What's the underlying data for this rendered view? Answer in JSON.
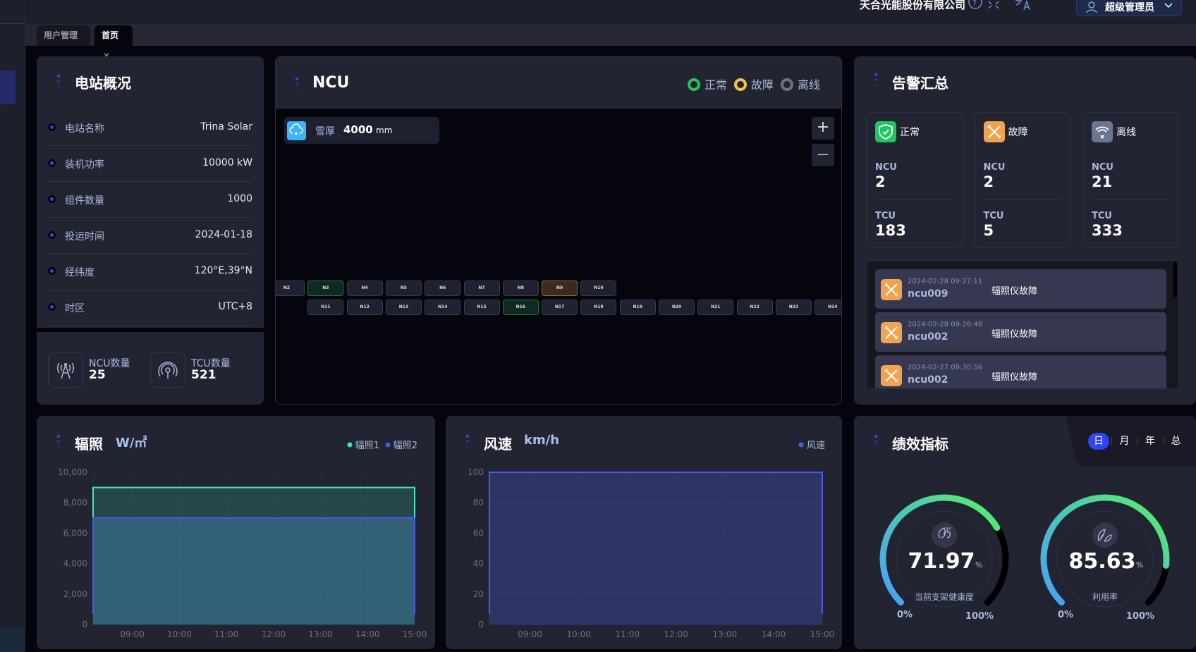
{
  "header": {
    "company": "天合光能股份有限公司",
    "user": "超级管理员",
    "icons": [
      "help-icon",
      "fullscreen-icon",
      "translate-icon",
      "bell-icon",
      "user-icon",
      "chevron-down-icon"
    ]
  },
  "tabs": [
    {
      "label": "用户管理",
      "active": false
    },
    {
      "label": "首页",
      "active": true,
      "close": "×"
    }
  ],
  "station": {
    "title": "电站概况",
    "rows": [
      {
        "label": "电站名称",
        "value": "Trina Solar"
      },
      {
        "label": "装机功率",
        "value": "10000 kW"
      },
      {
        "label": "组件数量",
        "value": "1000"
      },
      {
        "label": "投运时间",
        "value": "2024-01-18"
      },
      {
        "label": "经纬度",
        "value": "120°E,39°N"
      },
      {
        "label": "时区",
        "value": "UTC+8"
      }
    ],
    "ncu_label": "NCU数量",
    "ncu_count": "25",
    "tcu_label": "TCU数量",
    "tcu_count": "521"
  },
  "ncu": {
    "title": "NCU",
    "legend": [
      {
        "label": "正常",
        "color": "#22c55e"
      },
      {
        "label": "故障",
        "color": "#f5c542"
      },
      {
        "label": "离线",
        "color": "#6b7385"
      }
    ],
    "snow_label": "雪厚",
    "snow_value": "4000",
    "snow_unit": "mm",
    "zoom_in": "+",
    "zoom_out": "—",
    "row1": [
      {
        "id": "N2",
        "s": ""
      },
      {
        "id": "N3",
        "s": "ok"
      },
      {
        "id": "N4",
        "s": ""
      },
      {
        "id": "N5",
        "s": ""
      },
      {
        "id": "N6",
        "s": ""
      },
      {
        "id": "N7",
        "s": ""
      },
      {
        "id": "N8",
        "s": ""
      },
      {
        "id": "N9",
        "s": "fault"
      },
      {
        "id": "N10",
        "s": ""
      }
    ],
    "row2": [
      {
        "id": "N11",
        "s": ""
      },
      {
        "id": "N12",
        "s": ""
      },
      {
        "id": "N13",
        "s": ""
      },
      {
        "id": "N14",
        "s": ""
      },
      {
        "id": "N15",
        "s": ""
      },
      {
        "id": "N16",
        "s": "ok"
      },
      {
        "id": "N17",
        "s": ""
      },
      {
        "id": "N18",
        "s": ""
      },
      {
        "id": "N19",
        "s": ""
      },
      {
        "id": "N20",
        "s": ""
      },
      {
        "id": "N21",
        "s": ""
      },
      {
        "id": "N22",
        "s": ""
      },
      {
        "id": "N23",
        "s": ""
      },
      {
        "id": "N24",
        "s": ""
      }
    ]
  },
  "alarm": {
    "title": "告警汇总",
    "cards": [
      {
        "status": "正常",
        "color": "#22c55e",
        "ncu_label": "NCU",
        "ncu": "2",
        "tcu_label": "TCU",
        "tcu": "183"
      },
      {
        "status": "故障",
        "color": "#f3a34e",
        "ncu_label": "NCU",
        "ncu": "2",
        "tcu_label": "TCU",
        "tcu": "5"
      },
      {
        "status": "离线",
        "color": "#6b7690",
        "ncu_label": "NCU",
        "ncu": "21",
        "tcu_label": "TCU",
        "tcu": "333"
      }
    ],
    "items": [
      {
        "time": "2024-02-28 09:27:11",
        "device": "ncu009",
        "msg": "辐照仪故障"
      },
      {
        "time": "2024-02-28 09:26:48",
        "device": "ncu002",
        "msg": "辐照仪故障"
      },
      {
        "time": "2024-02-27 09:30:56",
        "device": "ncu002",
        "msg": "辐照仪故障"
      }
    ]
  },
  "perf": {
    "title": "绩效指标",
    "periods": [
      "日",
      "月",
      "年",
      "总"
    ],
    "active_period": "日",
    "gauges": [
      {
        "value": "71.97",
        "unit": "%",
        "label": "当前支架健康度",
        "min": "0%",
        "max": "100%",
        "fraction": 0.7197,
        "icon": "plug-leaf-icon"
      },
      {
        "value": "85.63",
        "unit": "%",
        "label": "利用率",
        "min": "0%",
        "max": "100%",
        "fraction": 0.8563,
        "icon": "leaves-icon"
      }
    ]
  },
  "chart_data": [
    {
      "type": "area",
      "title": "辐照",
      "unit": "W/㎡",
      "ylim": [
        0,
        10000
      ],
      "yticks": [
        "0",
        "2,000",
        "4,000",
        "6,000",
        "8,000",
        "10,000"
      ],
      "xticks": [
        "09:00",
        "10:00",
        "11:00",
        "12:00",
        "13:00",
        "14:00",
        "15:00"
      ],
      "xrange": [
        "08:10",
        "15:00"
      ],
      "grid": true,
      "legend": "top-right",
      "x": [
        "08:10",
        "09:00",
        "10:00",
        "11:00",
        "12:00",
        "13:00",
        "14:00",
        "15:00"
      ],
      "series": [
        {
          "name": "辐照1",
          "color": "#3ee6c1",
          "values": [
            9000,
            9000,
            9000,
            9000,
            9000,
            9000,
            9000,
            9000
          ]
        },
        {
          "name": "辐照2",
          "color": "#4a5be0",
          "values": [
            7000,
            7000,
            7000,
            7000,
            7000,
            7000,
            7000,
            7000
          ]
        }
      ]
    },
    {
      "type": "area",
      "title": "风速",
      "unit": "km/h",
      "ylim": [
        0,
        100
      ],
      "yticks": [
        "0",
        "20",
        "40",
        "60",
        "80",
        "100"
      ],
      "xticks": [
        "09:00",
        "10:00",
        "11:00",
        "12:00",
        "13:00",
        "14:00",
        "15:00"
      ],
      "xrange": [
        "08:10",
        "15:00"
      ],
      "grid": true,
      "legend": "top-right",
      "x": [
        "08:10",
        "09:00",
        "10:00",
        "11:00",
        "12:00",
        "13:00",
        "14:00",
        "15:00"
      ],
      "series": [
        {
          "name": "风速",
          "color": "#4a5be0",
          "values": [
            100,
            100,
            100,
            100,
            100,
            100,
            100,
            100
          ]
        }
      ]
    }
  ]
}
